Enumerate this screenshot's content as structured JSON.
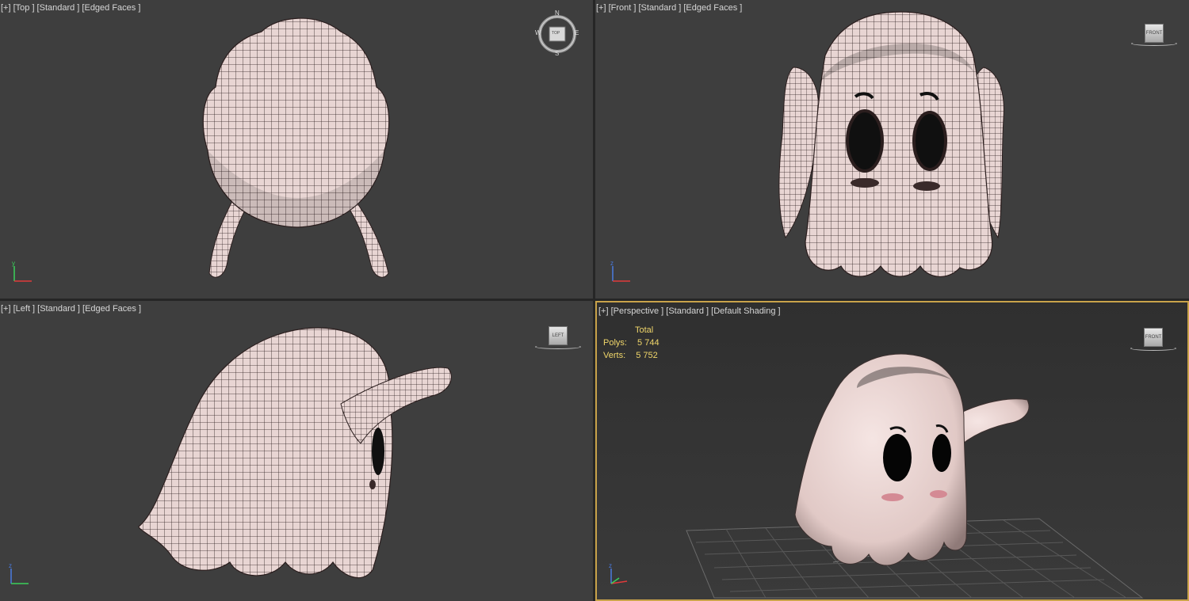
{
  "viewports": {
    "top": {
      "label": "[+] [Top ] [Standard ] [Edged Faces ]",
      "cube_label": "TOP",
      "compass": [
        "N",
        "E",
        "S",
        "W"
      ]
    },
    "front": {
      "label": "[+] [Front ] [Standard ] [Edged Faces ]",
      "cube_label": "FRONT"
    },
    "left": {
      "label": "[+] [Left ] [Standard ] [Edged Faces ]",
      "cube_label": "LEFT"
    },
    "perspective": {
      "label": "[+] [Perspective ] [Standard ] [Default Shading ]",
      "cube_label": "FRONT",
      "stats": {
        "header": "Total",
        "polys_label": "Polys:",
        "polys_value": "5 744",
        "verts_label": "Verts:",
        "verts_value": "5 752"
      }
    }
  },
  "axis_labels": {
    "x": "x",
    "y": "y",
    "z": "z"
  },
  "colors": {
    "viewport_bg": "#3e3e3e",
    "mesh_fill": "#e6d2d0",
    "wire": "#2a1f1f",
    "active_border": "#c9a34a",
    "stats_text": "#f0d66a",
    "axis_x": "#e03a3a",
    "axis_y": "#3ad05a",
    "axis_z": "#4a7be0"
  }
}
